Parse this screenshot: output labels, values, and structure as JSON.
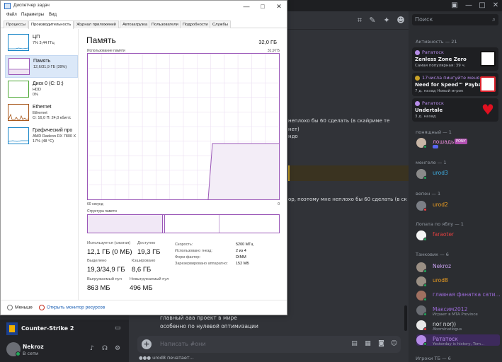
{
  "discord": {
    "search_placeholder": "Поиск",
    "messages": [
      "неплохо бы 60 сделать (в скайриме те",
      "нет)",
      "ндо",
      "ор, поэтому мне неплохо бы 60 сделать (в ска..."
    ],
    "chat_tail": [
      "главный ааа проект в мире",
      "особенно по нулевой оптимизации"
    ],
    "compose_placeholder": "Написать #они",
    "typing_indicator": "urod8 печатает...",
    "game": {
      "name": "Counter-Strike 2"
    },
    "user": {
      "name": "Nekroz",
      "status": "В сети"
    },
    "activity_header": "Активность — 21",
    "activity_cards": [
      {
        "user": "Рататоск",
        "title": "Zenless Zone Zero",
        "subtitle": "Самая популярная: 39 ч."
      },
      {
        "user": "17числа пингуйте меня ...",
        "title": "Need for Speed™ Payback",
        "subtitle": "7 д. назад   Новый игрок"
      },
      {
        "user": "Рататоск",
        "title": "Undertale",
        "subtitle": "3 д. назад"
      }
    ],
    "groups": [
      {
        "label": "понящный — 1",
        "members": [
          {
            "name": "лошадь",
            "badge": "PONY",
            "color": "#e68ad8",
            "sub": ""
          }
        ]
      },
      {
        "label": "менгеле — 1",
        "members": [
          {
            "name": "urod3",
            "badge": "",
            "color": "#3fb2e8",
            "sub": ""
          }
        ]
      },
      {
        "label": "вепен — 1",
        "members": [
          {
            "name": "urod2",
            "badge": "",
            "color": "#f0a020",
            "sub": ""
          }
        ]
      },
      {
        "label": "Лопата по яблу — 1",
        "members": [
          {
            "name": "faraoter",
            "badge": "",
            "color": "#e04040",
            "sub": ""
          }
        ]
      },
      {
        "label": "Танковик — 6",
        "members": [
          {
            "name": "Nekroz",
            "badge": "",
            "color": "#c7a0f0",
            "sub": ""
          },
          {
            "name": "urod8",
            "badge": "",
            "color": "#f0a020",
            "sub": ""
          },
          {
            "name": "главная фанатка сати...",
            "badge": "",
            "color": "#9b6ad8",
            "sub": ""
          },
          {
            "name": "Максим2012",
            "badge": "",
            "color": "#9b6ad8",
            "sub": "Играет в MTA Province"
          },
          {
            "name": "nor nor))",
            "badge": "",
            "color": "#dbdee1",
            "sub": "Abominatlogus"
          },
          {
            "name": "Рататоск",
            "badge": "",
            "color": "#b58be8",
            "sub": "Yesterday is history, Tom..."
          }
        ]
      }
    ],
    "bottom_group": "Игроки ТБ — 6"
  },
  "taskmanager": {
    "title": "Диспетчер задач",
    "menu": [
      "Файл",
      "Параметры",
      "Вид"
    ],
    "tabs": [
      "Процессы",
      "Производительность",
      "Журнал приложений",
      "Автозагрузка",
      "Пользователи",
      "Подробности",
      "Службы"
    ],
    "active_tab": 1,
    "sidebar": [
      {
        "name": "ЦП",
        "line2": "7% 3,44 ГГц",
        "line3": "",
        "color": "#1a86c8"
      },
      {
        "name": "Память",
        "line2": "12,6/31,9 ГБ (39%)",
        "line3": "",
        "color": "#9b57b8"
      },
      {
        "name": "Диск 0 (C: D:)",
        "line2": "HDD",
        "line3": "0%",
        "color": "#4da834"
      },
      {
        "name": "Ethernet",
        "line2": "Ethernet",
        "line3": "О: 16,0 П: 24,0 кбит/с",
        "color": "#a8581c"
      },
      {
        "name": "Графический про",
        "line2": "AMD Radeon RX 7800 X",
        "line3": "17% (48 °C)",
        "color": "#1a86c8"
      }
    ],
    "panel": {
      "title": "Память",
      "total": "32,0 ГБ",
      "usage_label": "Использование памяти",
      "usage_max": "31,9 ГБ",
      "time_label": "60 секунд",
      "time_end": "0",
      "structure_label": "Структура памяти",
      "stats": [
        {
          "label": "Используется (сжатая)",
          "value": "12,1 ГБ (0 МБ)"
        },
        {
          "label": "Доступно",
          "value": "19,3 ГБ"
        },
        {
          "label": "Выделено",
          "value": "19,3/34,9 ГБ"
        },
        {
          "label": "Кэшировано",
          "value": "8,6 ГБ"
        },
        {
          "label": "Выгружаемый пул",
          "value": "863 МБ"
        },
        {
          "label": "Невыгружаемый пул",
          "value": "496 МБ"
        }
      ],
      "details": [
        {
          "label": "Скорость:",
          "value": "5200 МГц"
        },
        {
          "label": "Использовано гнезд:",
          "value": "2 из 4"
        },
        {
          "label": "Форм-фактор:",
          "value": "DIMM"
        },
        {
          "label": "Зарезервировано аппаратно:",
          "value": "152 МБ"
        }
      ]
    },
    "footer": {
      "less": "Меньше",
      "monitor": "Открыть монитор ресурсов"
    },
    "accent": "#9b57b8"
  }
}
